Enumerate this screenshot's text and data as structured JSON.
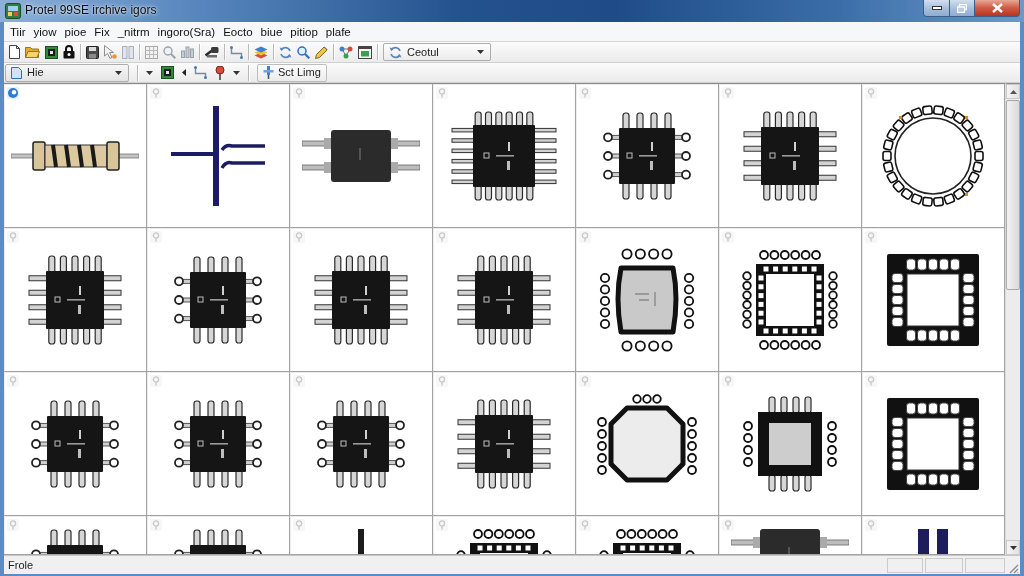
{
  "window": {
    "title": "Protel 99SE irchive igors"
  },
  "menu": [
    "Tiir",
    "yiow",
    "pioe",
    "Fix",
    "_nitrm",
    "ingoro(Sra)",
    "Eocto",
    "biue",
    "pitiop",
    "plafe"
  ],
  "toolbar": {
    "dropdown": {
      "value": "Ceotul"
    }
  },
  "toolbar_2": {
    "combo": {
      "value": "Hie"
    },
    "button": {
      "label": "Sct Limg"
    }
  },
  "footprints": {
    "rows": [
      {
        "cells": [
          {
            "kind": "resistor",
            "selected": true
          },
          {
            "kind": "capacitor",
            "selected": false
          },
          {
            "kind": "soic",
            "selected": false
          },
          {
            "kind": "qfp-wide",
            "selected": false
          },
          {
            "kind": "qfp-round",
            "selected": false
          },
          {
            "kind": "qfp",
            "selected": false
          },
          {
            "kind": "ring",
            "selected": false
          }
        ]
      },
      {
        "cells": [
          {
            "kind": "qfp",
            "selected": false
          },
          {
            "kind": "qfp-round",
            "selected": false
          },
          {
            "kind": "qfp",
            "selected": false
          },
          {
            "kind": "qfp",
            "selected": false
          },
          {
            "kind": "plcc",
            "selected": false
          },
          {
            "kind": "frame",
            "selected": false
          },
          {
            "kind": "frame-band",
            "selected": false
          }
        ]
      },
      {
        "cells": [
          {
            "kind": "qfp-round",
            "selected": false
          },
          {
            "kind": "qfp-round",
            "selected": false
          },
          {
            "kind": "qfp-round",
            "selected": false
          },
          {
            "kind": "qfp",
            "selected": false
          },
          {
            "kind": "octagon",
            "selected": false
          },
          {
            "kind": "light-frame",
            "selected": false
          },
          {
            "kind": "frame-band",
            "selected": false
          }
        ]
      },
      {
        "cells": [
          {
            "kind": "qfp-round",
            "selected": false
          },
          {
            "kind": "qfp-round",
            "selected": false
          },
          {
            "kind": "stem",
            "selected": false
          },
          {
            "kind": "frame",
            "selected": false
          },
          {
            "kind": "frame",
            "selected": false
          },
          {
            "kind": "soic",
            "selected": false
          },
          {
            "kind": "bar",
            "selected": false
          }
        ]
      }
    ]
  },
  "status_bar": {
    "text": "Frole"
  }
}
